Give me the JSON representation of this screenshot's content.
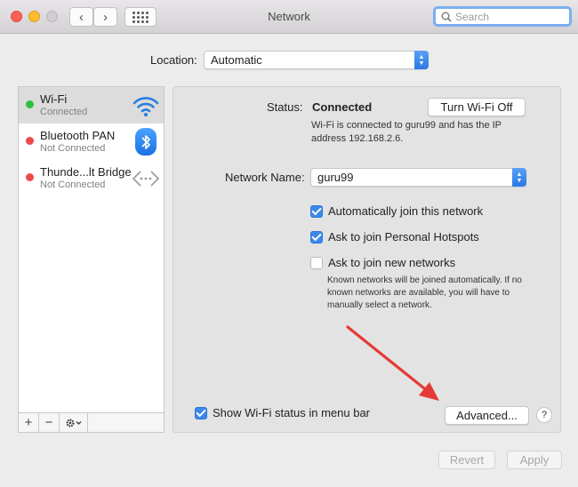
{
  "window": {
    "title": "Network",
    "back_label": "‹",
    "forward_label": "›"
  },
  "search": {
    "placeholder": "Search"
  },
  "location": {
    "label": "Location:",
    "value": "Automatic"
  },
  "sidebar": {
    "items": [
      {
        "name": "Wi-Fi",
        "status": "Connected",
        "dot_color": "#2fc13b",
        "selected": true,
        "icon": "wifi-icon"
      },
      {
        "name": "Bluetooth PAN",
        "status": "Not Connected",
        "dot_color": "#ed4a4a",
        "selected": false,
        "icon": "bluetooth-icon"
      },
      {
        "name": "Thunde...lt Bridge",
        "status": "Not Connected",
        "dot_color": "#ed4a4a",
        "selected": false,
        "icon": "thunderbolt-bridge-icon"
      }
    ],
    "tools": {
      "add": "+",
      "remove": "−"
    }
  },
  "pane": {
    "status_label": "Status:",
    "status_value": "Connected",
    "status_desc": "Wi-Fi is connected to guru99 and has the IP address 192.168.2.6.",
    "turn_off_label": "Turn Wi-Fi Off",
    "network_name_label": "Network Name:",
    "network_name_value": "guru99",
    "options": [
      {
        "label": "Automatically join this network",
        "checked": true
      },
      {
        "label": "Ask to join Personal Hotspots",
        "checked": true
      },
      {
        "label": "Ask to join new networks",
        "checked": false
      }
    ],
    "join_help": "Known networks will be joined automatically. If no known networks are available, you will have to manually select a network.",
    "show_status_label": "Show Wi-Fi status in menu bar",
    "show_status_checked": true,
    "advanced_label": "Advanced...",
    "help_label": "?"
  },
  "footer": {
    "revert_label": "Revert",
    "apply_label": "Apply"
  },
  "colors": {
    "accent": "#3b89ec",
    "annotation_arrow": "#e53935"
  }
}
